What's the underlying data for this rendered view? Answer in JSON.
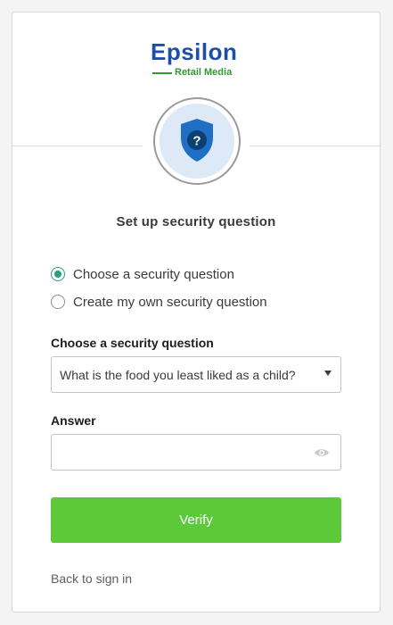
{
  "brand": {
    "name": "Epsilon",
    "tagline": "Retail Media",
    "primary_color": "#1e4fa8",
    "secondary_color": "#2f9a2f"
  },
  "badge": {
    "icon": "shield-question-icon",
    "glyph": "?"
  },
  "title": "Set up security question",
  "options": [
    {
      "label": "Choose a security question",
      "selected": true
    },
    {
      "label": "Create my own security question",
      "selected": false
    }
  ],
  "question_field": {
    "label": "Choose a security question",
    "value": "What is the food you least liked as a child?"
  },
  "answer_field": {
    "label": "Answer",
    "value": "",
    "icon": "eye-icon"
  },
  "verify_button": {
    "label": "Verify",
    "color": "#5cc93b"
  },
  "back_link": "Back to sign in"
}
